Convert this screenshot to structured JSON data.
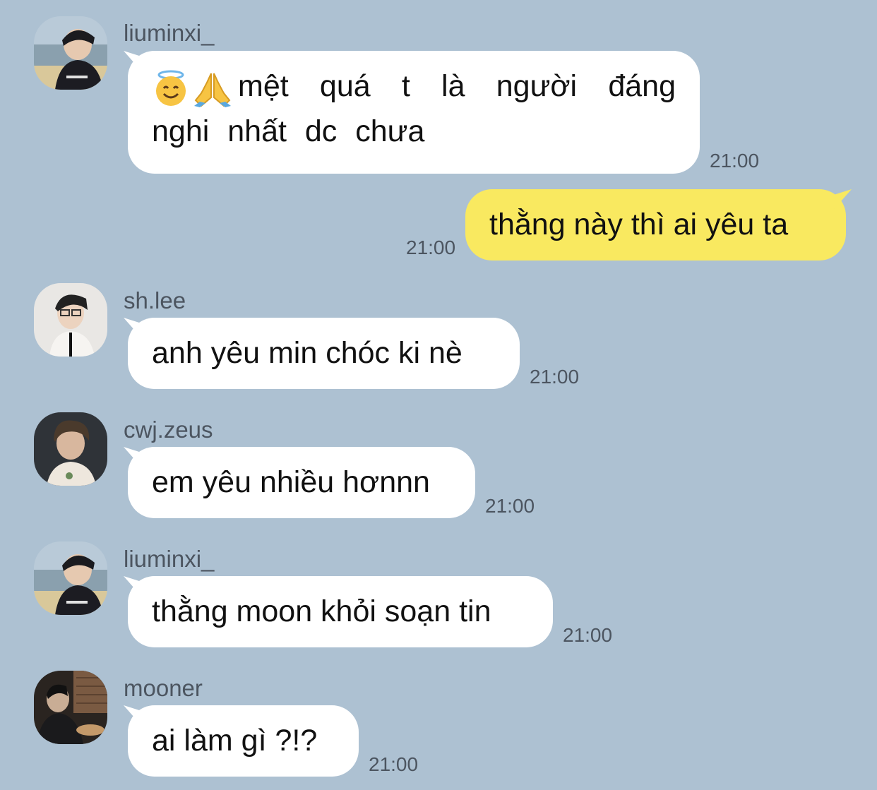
{
  "messages": [
    {
      "sender": "liuminxi_",
      "avatar": "liuminxi-avatar",
      "icons": [
        "smiling-face-with-halo-icon",
        "folded-hands-icon"
      ],
      "text": "mệt quá t là người đáng nghi nhất dc chưa",
      "time": "21:00",
      "direction": "incoming"
    },
    {
      "text": "thằng này thì ai yêu ta",
      "time": "21:00",
      "direction": "outgoing"
    },
    {
      "sender": "sh.lee",
      "avatar": "sh-lee-avatar",
      "text": "anh yêu min chóc ki nè",
      "time": "21:00",
      "direction": "incoming"
    },
    {
      "sender": "cwj.zeus",
      "avatar": "cwj-zeus-avatar",
      "text": "em yêu nhiều hơnnn",
      "time": "21:00",
      "direction": "incoming"
    },
    {
      "sender": "liuminxi_",
      "avatar": "liuminxi-avatar",
      "text": "thằng moon khỏi soạn tin",
      "time": "21:00",
      "direction": "incoming"
    },
    {
      "sender": "mooner",
      "avatar": "mooner-avatar",
      "text": "ai làm gì ?!?",
      "time": "21:00",
      "direction": "incoming"
    }
  ],
  "colors": {
    "background": "#adc1d2",
    "incoming_bubble": "#ffffff",
    "outgoing_bubble": "#f9e960",
    "meta_text": "#4c5560"
  }
}
